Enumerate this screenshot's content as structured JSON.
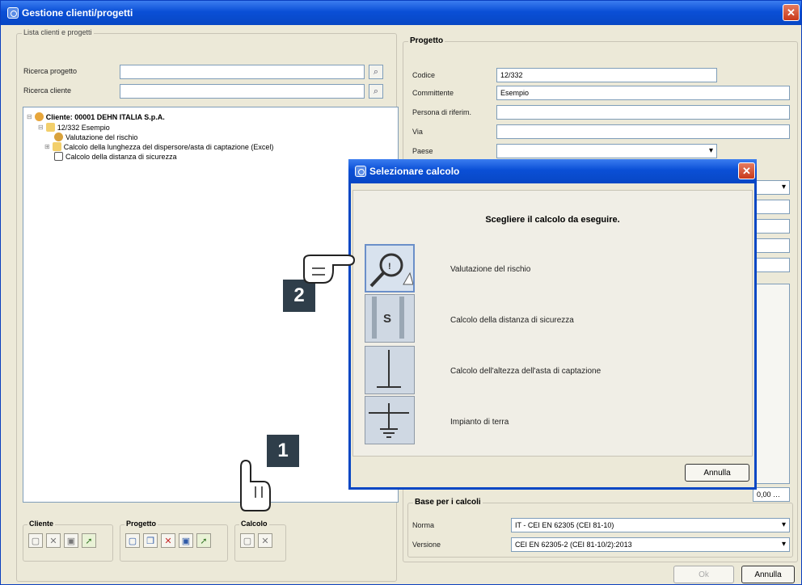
{
  "window": {
    "title": "Gestione clienti/progetti",
    "close_glyph": "✕"
  },
  "left": {
    "group_label": "Lista clienti e progetti",
    "search_project_label": "Ricerca progetto",
    "search_client_label": "Ricerca cliente",
    "search_project_value": "",
    "search_client_value": "",
    "tree": {
      "client": "Cliente: 00001 DEHN ITALIA S.p.A.",
      "project": "12/332 Esempio",
      "items": [
        "Valutazione del rischio",
        "Calcolo della lunghezza del dispersore/asta di captazione (Excel)",
        "Calcolo della distanza di sicurezza"
      ]
    },
    "toolbar": {
      "cliente": "Cliente",
      "progetto": "Progetto",
      "calcolo": "Calcolo"
    }
  },
  "right": {
    "group_label": "Progetto",
    "fields": [
      {
        "label": "Codice",
        "value": "12/332"
      },
      {
        "label": "Committente",
        "value": "Esempio"
      },
      {
        "label": "Persona di riferim.",
        "value": ""
      },
      {
        "label": "Via",
        "value": ""
      },
      {
        "label": "Paese",
        "value": ""
      }
    ],
    "costo_value": "0,00",
    "base_group_label": "Base per i calcoli",
    "norma_label": "Norma",
    "norma_value": "IT    - CEI EN 62305 (CEI 81-10)",
    "versione_label": "Versione",
    "versione_value": "CEI EN 62305-2 (CEI 81-10/2):2013",
    "ok_label": "Ok",
    "cancel_label": "Annulla"
  },
  "dialog": {
    "title": "Selezionare calcolo",
    "heading": "Scegliere il calcolo da eseguire.",
    "options": [
      "Valutazione del rischio",
      "Calcolo della distanza di sicurezza",
      "Calcolo dell'altezza dell'asta di captazione",
      "Impianto di terra"
    ],
    "distance_glyph": "S",
    "cancel_label": "Annulla"
  },
  "callouts": {
    "step1": "1",
    "step2": "2"
  },
  "colors": {
    "titlebar": "#0a4fd6",
    "window_bg": "#ece9d8",
    "badge": "#2f3e4a"
  }
}
